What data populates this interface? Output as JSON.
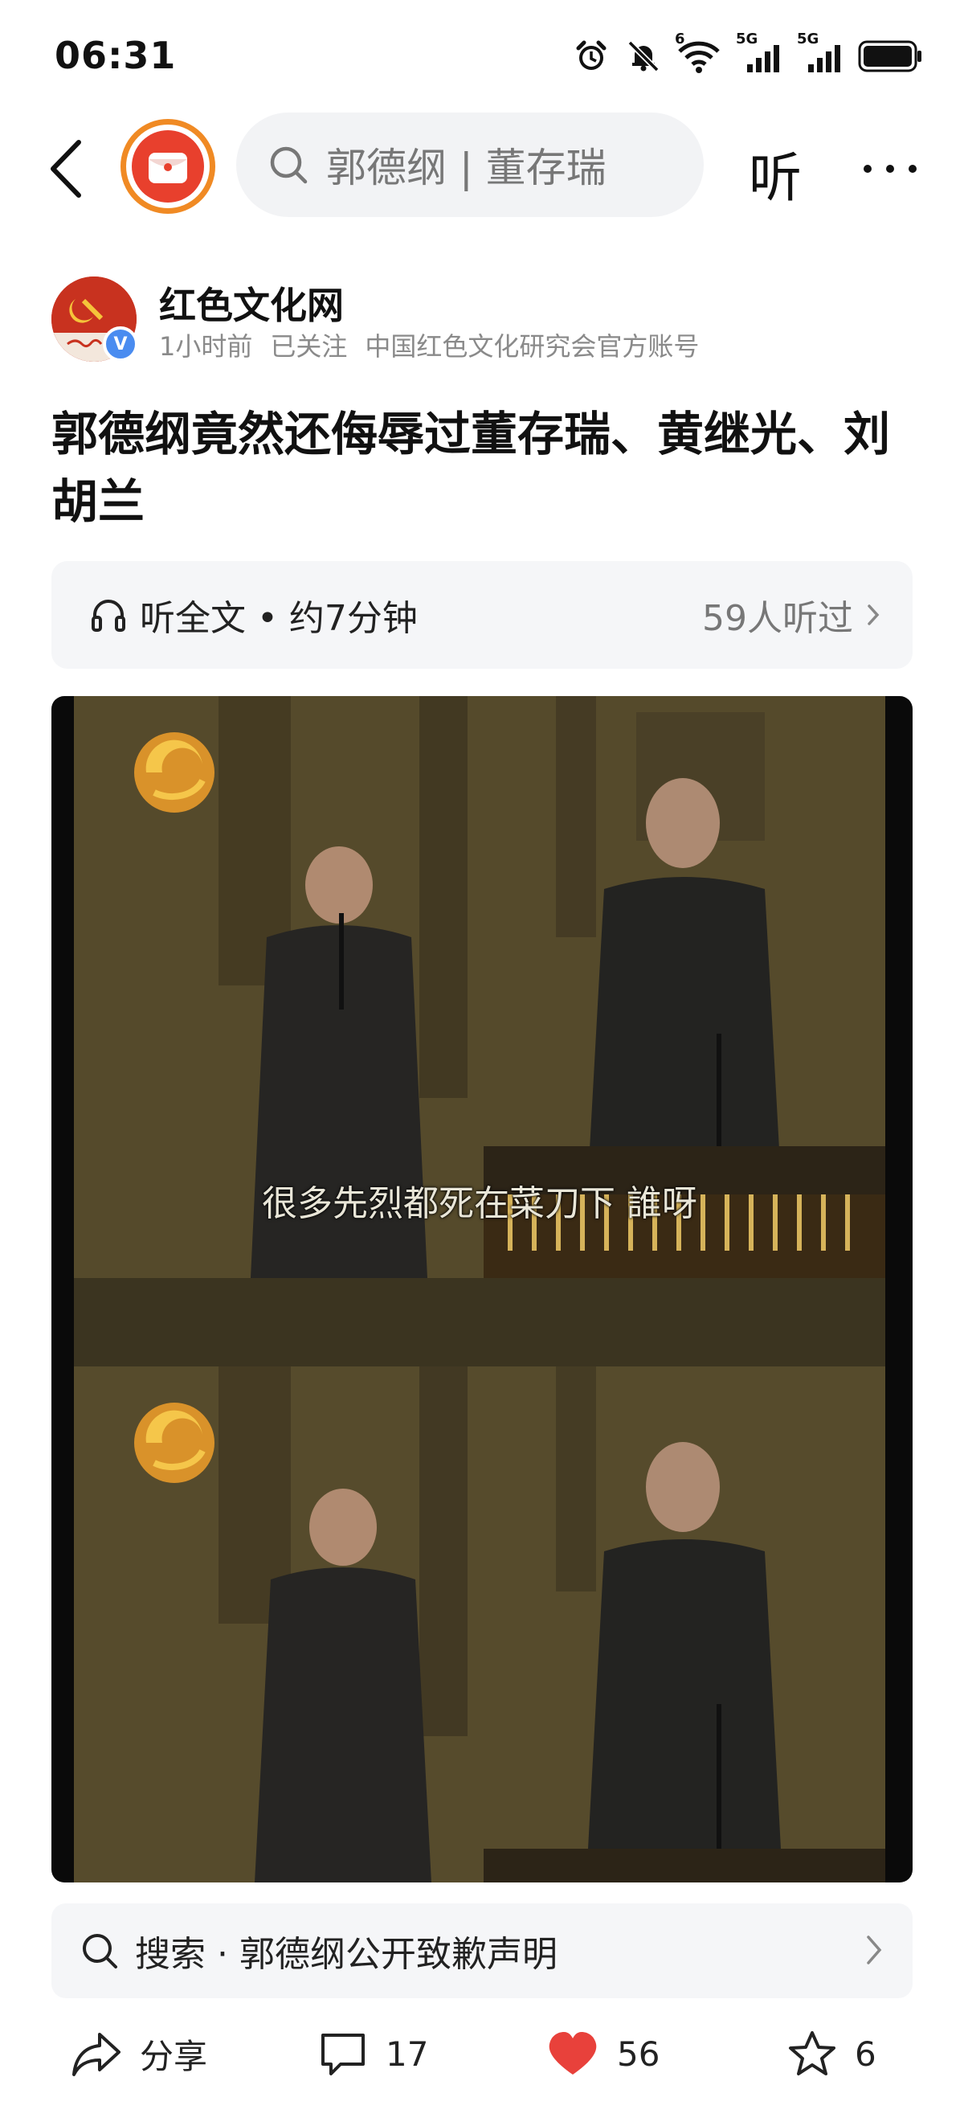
{
  "status_bar": {
    "time": "06:31",
    "signal_label_1": "5G",
    "signal_label_2": "5G",
    "wifi_label": "6"
  },
  "nav": {
    "search_text": "郭德纲 | 董存瑞",
    "listen_label": "听",
    "icons": [
      "back-arrow-icon",
      "app-logo-icon",
      "search-icon",
      "more-icon"
    ]
  },
  "author": {
    "name": "红色文化网",
    "time_ago": "1小时前",
    "follow_status": "已关注",
    "description": "中国红色文化研究会官方账号",
    "verify_mark": "V"
  },
  "article": {
    "title": "郭德纲竟然还侮辱过董存瑞、黄继光、刘胡兰",
    "listen_full": "听全文 • 约7分钟",
    "listeners": "59人听过",
    "subtitle": "很多先烈都死在菜刀下 誰呀"
  },
  "search_suggestion": {
    "text": "搜索 · 郭德纲公开致歉声明"
  },
  "actions": {
    "share_label": "分享",
    "comment_count": "17",
    "like_count": "56",
    "fav_count": "6"
  },
  "colors": {
    "like_red": "#e8413b",
    "logo_orange": "#f08a24",
    "logo_red": "#e8402d",
    "verify_blue": "#4a8cf0",
    "light_bg": "#f5f6f8"
  }
}
